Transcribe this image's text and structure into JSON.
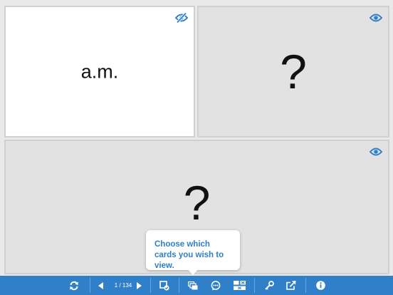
{
  "colors": {
    "accent": "#2f80c9",
    "hidden_card_bg": "#e2e2e2",
    "revealed_card_bg": "#ffffff"
  },
  "cards": [
    {
      "text": "a.m.",
      "state": "revealed",
      "toggle_icon": "eye-slash-icon"
    },
    {
      "text": "?",
      "state": "hidden",
      "toggle_icon": "eye-icon"
    },
    {
      "text": "?",
      "state": "hidden",
      "toggle_icon": "eye-icon"
    }
  ],
  "tooltip": {
    "text": "Choose which cards you wish to view."
  },
  "toolbar": {
    "page_indicator": "1 / 134",
    "buttons": [
      "refresh-icon",
      "previous-icon",
      "next-icon",
      "mark-complete-icon",
      "select-cards-icon",
      "hint-icon",
      "layout-icon",
      "key-icon",
      "share-icon",
      "info-icon"
    ]
  }
}
